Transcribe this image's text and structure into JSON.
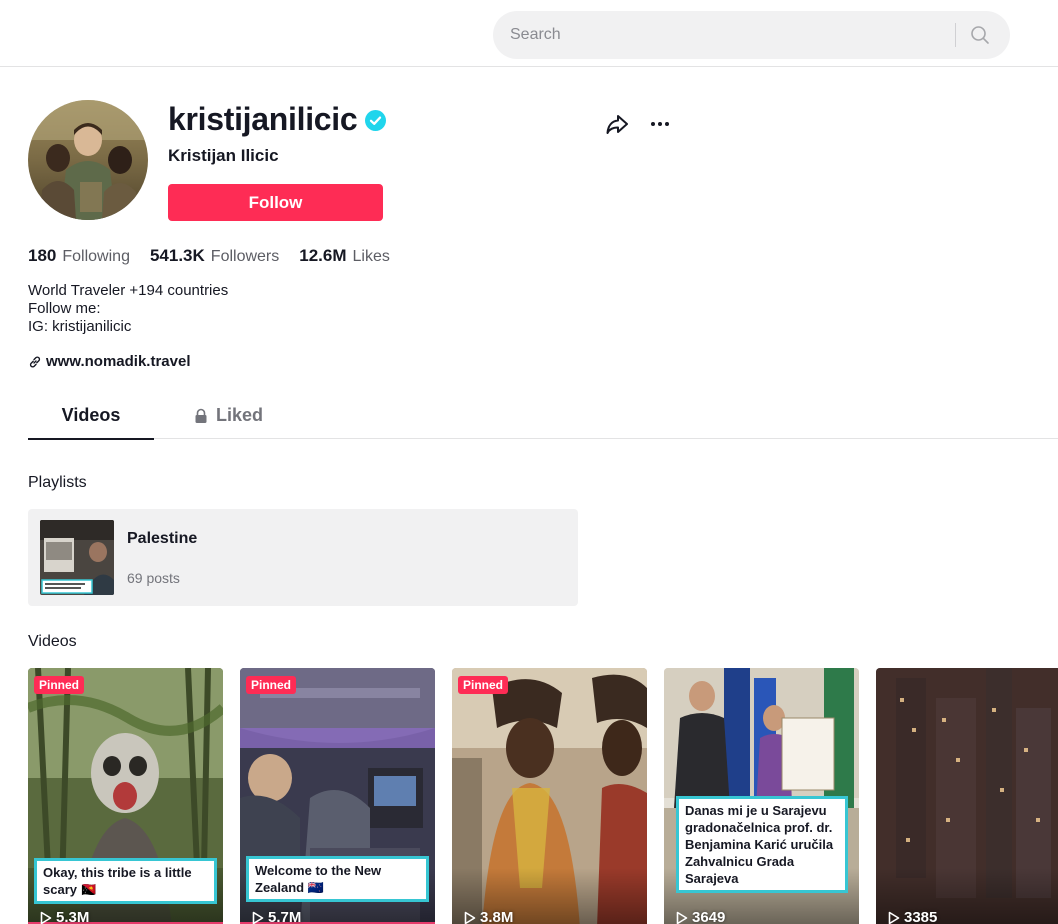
{
  "search": {
    "placeholder": "Search"
  },
  "profile": {
    "username": "kristijanilicic",
    "nickname": "Kristijan Ilicic",
    "follow_label": "Follow",
    "verified": true,
    "stats": [
      {
        "value": "180",
        "label": "Following"
      },
      {
        "value": "541.3K",
        "label": "Followers"
      },
      {
        "value": "12.6M",
        "label": "Likes"
      }
    ],
    "bio": [
      "World Traveler +194 countries",
      "Follow me:",
      "IG: kristijanilicic"
    ],
    "link": "www.nomadik.travel"
  },
  "tabs": [
    {
      "label": "Videos",
      "active": true
    },
    {
      "label": "Liked",
      "active": false,
      "icon": "lock-icon"
    }
  ],
  "playlists": {
    "title": "Playlists",
    "items": [
      {
        "name": "Palestine",
        "count": "69 posts"
      }
    ]
  },
  "videos": {
    "title": "Videos",
    "items": [
      {
        "pinned": "Pinned",
        "caption": "Okay, this tribe is a little scary 🇵🇬",
        "views": "5.3M"
      },
      {
        "pinned": "Pinned",
        "caption": "Welcome to the New Zealand 🇳🇿",
        "views": "5.7M"
      },
      {
        "pinned": "Pinned",
        "caption": "",
        "views": "3.8M"
      },
      {
        "pinned": "",
        "caption": "Danas mi je u Sarajevu gradonačelnica prof. dr. Benjamina Karić uručila Zahvalnicu Grada Sarajeva",
        "views": "3649"
      },
      {
        "pinned": "",
        "caption": "",
        "views": "3385"
      }
    ]
  },
  "colors": {
    "accent": "#fe2c55",
    "verified": "#20d5ec",
    "caption_border": "#37c6d3",
    "text_primary": "#161823",
    "text_secondary": "#73747b"
  }
}
